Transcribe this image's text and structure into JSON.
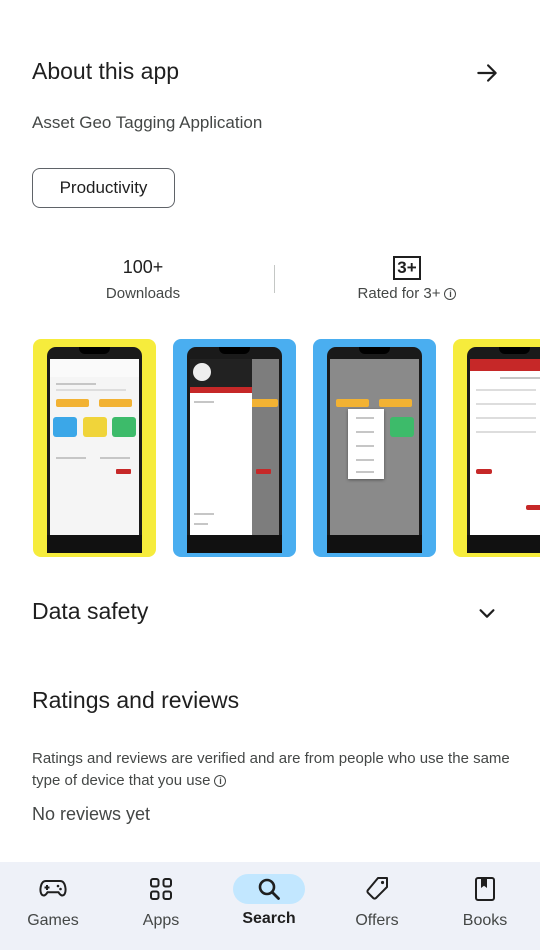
{
  "about": {
    "title": "About this app",
    "description": "Asset Geo Tagging Application",
    "category_chip": "Productivity"
  },
  "stats": {
    "downloads_value": "100+",
    "downloads_label": "Downloads",
    "rating_badge": "3+",
    "rating_label": "Rated for 3+"
  },
  "screenshots": {
    "backgrounds": [
      "#f6ec3c",
      "#4aaef0",
      "#4aaef0",
      "#f6ec3c"
    ]
  },
  "data_safety": {
    "title": "Data safety"
  },
  "ratings": {
    "title": "Ratings and reviews",
    "description": "Ratings and reviews are verified and are from people who use the same type of device that you use",
    "no_reviews": "No reviews yet"
  },
  "bottom_nav": {
    "items": [
      {
        "label": "Games",
        "icon": "gamepad-icon"
      },
      {
        "label": "Apps",
        "icon": "apps-grid-icon"
      },
      {
        "label": "Search",
        "icon": "search-icon",
        "active": true
      },
      {
        "label": "Offers",
        "icon": "tag-icon"
      },
      {
        "label": "Books",
        "icon": "bookmark-icon"
      }
    ],
    "active_color": "#c2e7ff"
  }
}
